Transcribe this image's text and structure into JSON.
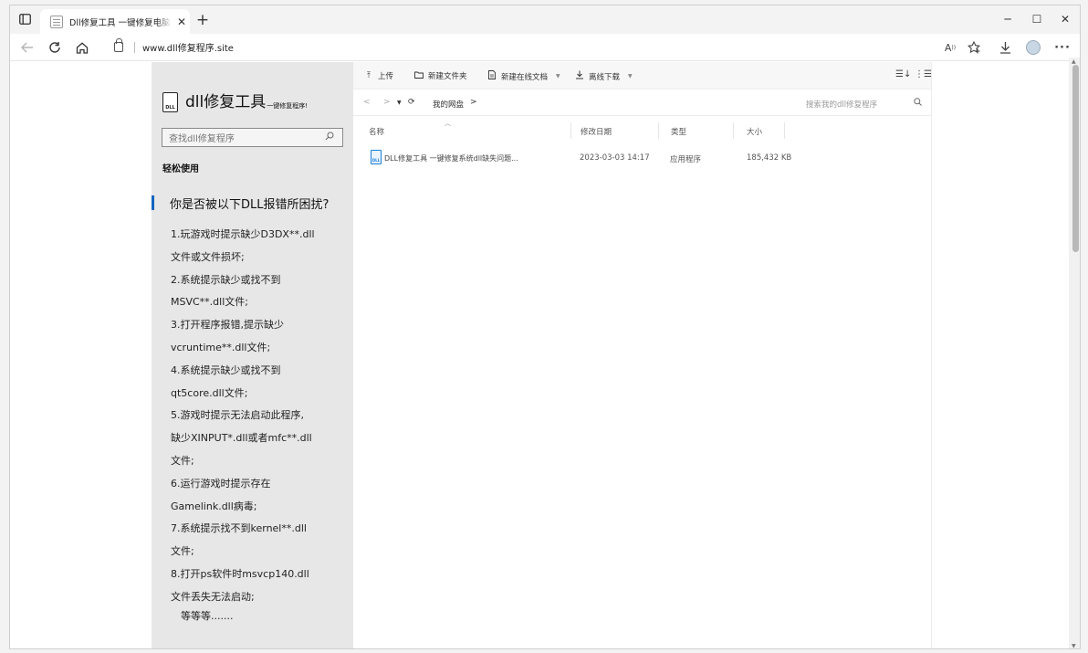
{
  "browser": {
    "tab_title": "Dll修复工具 一键修复电脑丢失Dll",
    "tab_close": "✕",
    "new_tab": "+",
    "url": "www.dll修复程序.site",
    "window_controls": {
      "minimize": "─",
      "maximize": "☐",
      "close": "✕"
    }
  },
  "sidebar": {
    "logo_icon_text": "DLL",
    "logo_title": "dll修复工具",
    "logo_subtitle": "一键修复程序!",
    "search_placeholder": "查找dll修复程序",
    "easy_use": "轻松使用",
    "question": "你是否被以下DLL报错所困扰?",
    "issues": [
      "1.玩游戏时提示缺少D3DX**.dll",
      "文件或文件损坏;",
      "2.系统提示缺少或找不到",
      "MSVC**.dll文件;",
      "3.打开程序报错,提示缺少",
      "vcruntime**.dll文件;",
      "4.系统提示缺少或找不到",
      "qt5core.dll文件;",
      "5.游戏时提示无法启动此程序,",
      "缺少XINPUT*.dll或者mfc**.dll",
      "文件;",
      "6.运行游戏时提示存在",
      "Gamelink.dll病毒;",
      "7.系统提示找不到kernel**.dll",
      "文件;",
      "8.打开ps软件时msvcp140.dll",
      "文件丢失无法启动;"
    ],
    "etc": "等等等......."
  },
  "file_manager": {
    "toolbar": {
      "upload": "上传",
      "new_folder": "新建文件夹",
      "new_online_doc": "新建在线文档",
      "offline_download": "离线下载"
    },
    "breadcrumb": "我的网盘",
    "breadcrumb_arrow": ">",
    "search_placeholder": "搜索我的dll修复程序",
    "columns": {
      "name": "名称",
      "modified": "修改日期",
      "type": "类型",
      "size": "大小"
    },
    "files": [
      {
        "name": "DLL修复工具 一键修复系统dll缺失问题...",
        "icon_text": "DLL",
        "modified": "2023-03-03 14:17",
        "type": "应用程序",
        "size": "185,432 KB"
      }
    ]
  },
  "colors": {
    "accent": "#1565c0",
    "file_icon": "#1a7ed6",
    "sidebar_bg": "#e7e7e7"
  }
}
